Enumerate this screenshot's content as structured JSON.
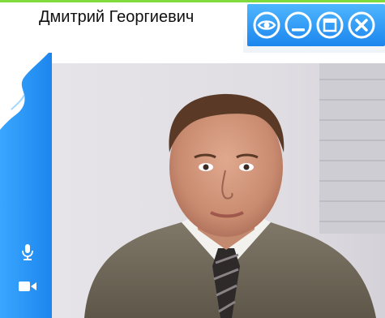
{
  "caller": {
    "name": "Дмитрий Георгиевич"
  },
  "window_controls": [
    {
      "name": "view-button",
      "icon": "eye-icon"
    },
    {
      "name": "minimize-button",
      "icon": "minimize-icon"
    },
    {
      "name": "maximize-button",
      "icon": "maximize-icon"
    },
    {
      "name": "close-button",
      "icon": "close-icon"
    }
  ],
  "sidebar": {
    "items": [
      {
        "name": "microphone-button",
        "icon": "microphone-icon"
      },
      {
        "name": "camera-button",
        "icon": "camera-icon"
      }
    ]
  },
  "colors": {
    "accent": "#1c86ee",
    "accent_light": "#4fb6ff",
    "top_strip": "#7fdc3c",
    "background": "#ffffff"
  }
}
